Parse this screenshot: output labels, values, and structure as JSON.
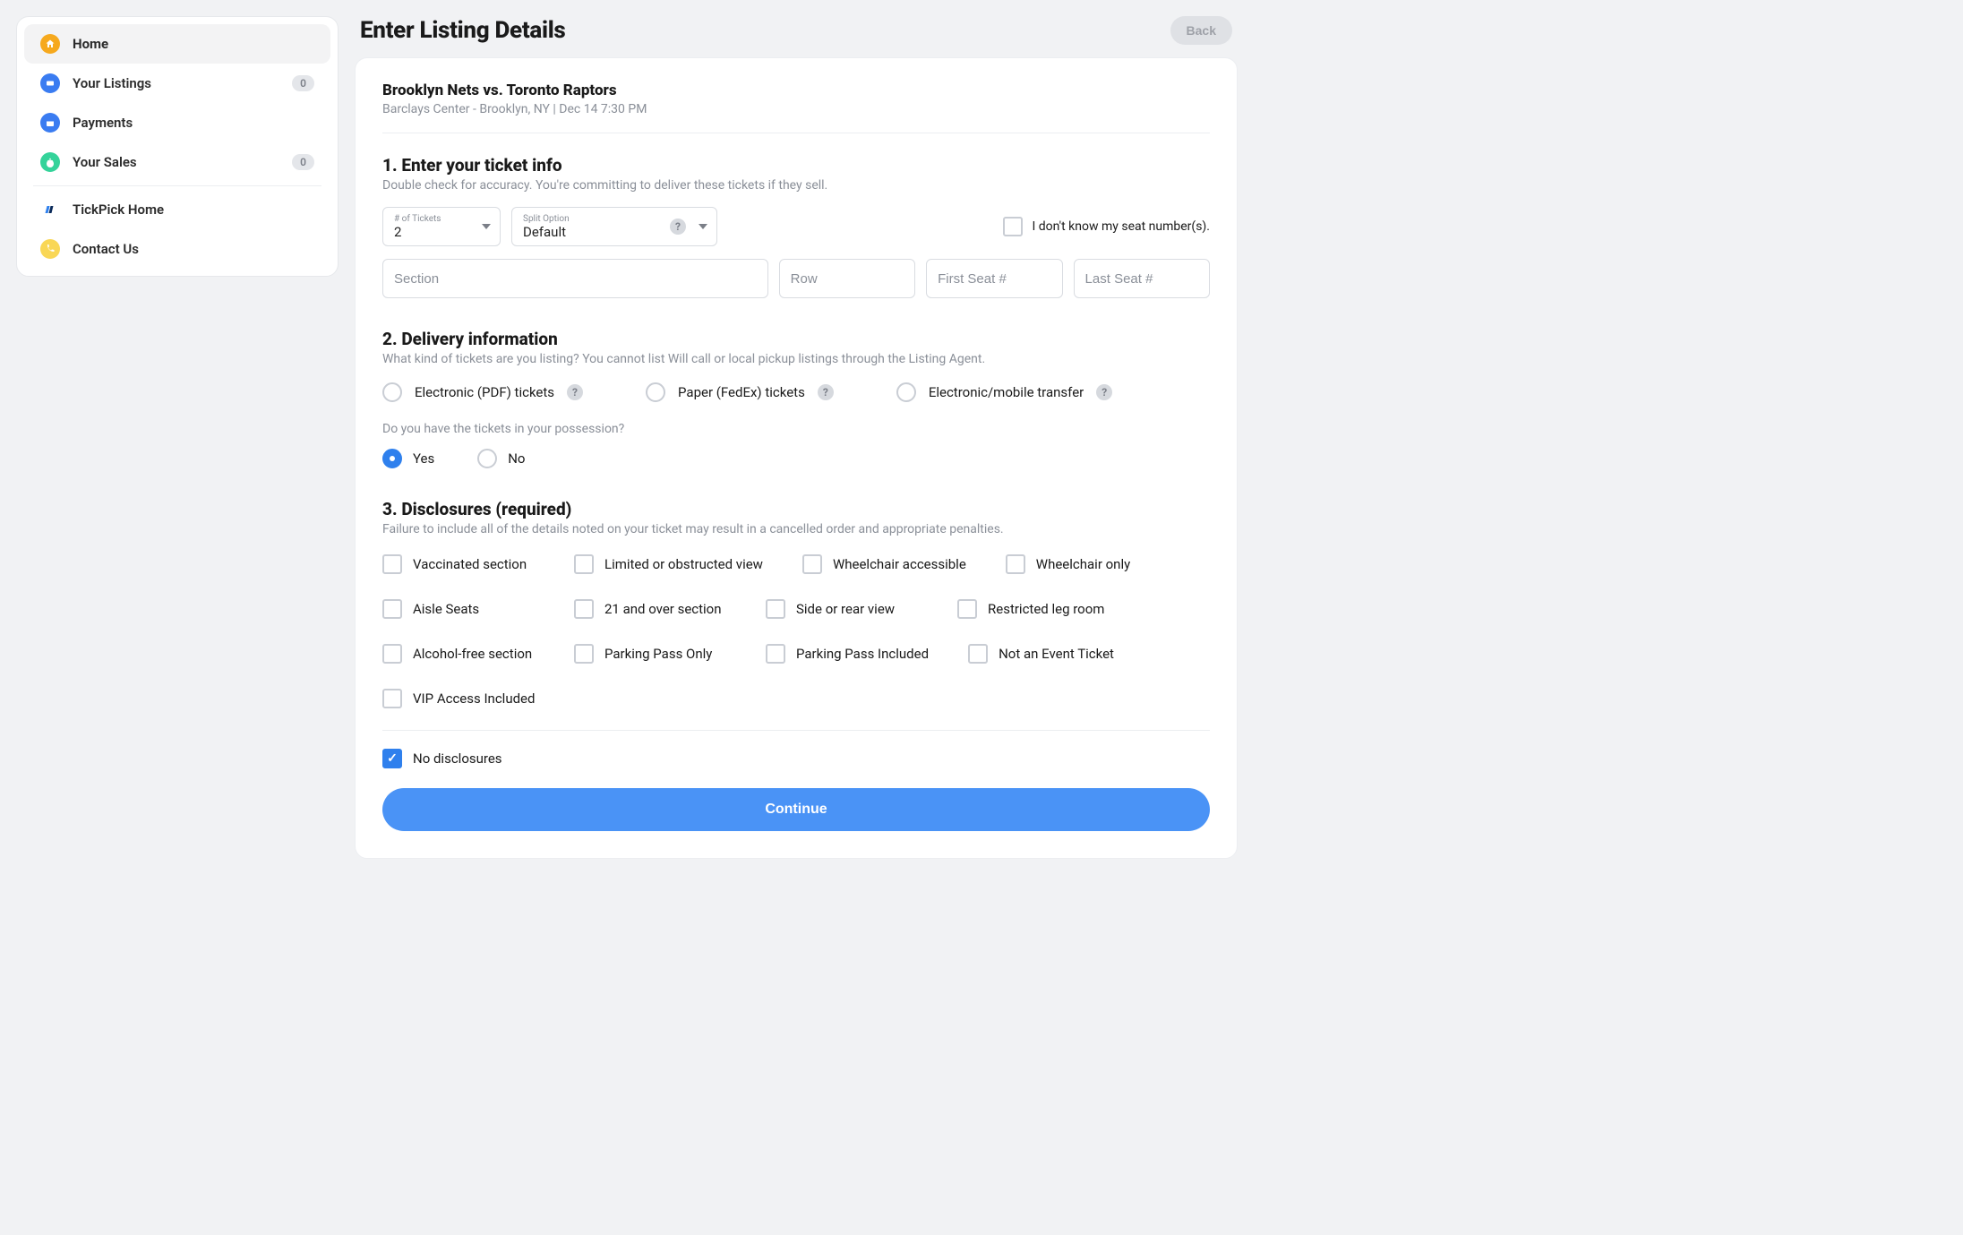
{
  "sidebar": {
    "items": [
      {
        "label": "Home"
      },
      {
        "label": "Your Listings",
        "badge": "0"
      },
      {
        "label": "Payments"
      },
      {
        "label": "Your Sales",
        "badge": "0"
      },
      {
        "label": "TickPick Home"
      },
      {
        "label": "Contact Us"
      }
    ]
  },
  "header": {
    "title": "Enter Listing Details",
    "back": "Back"
  },
  "event": {
    "title": "Brooklyn Nets vs. Toronto Raptors",
    "sub": "Barclays Center - Brooklyn, NY | Dec 14 7:30 PM"
  },
  "section1": {
    "heading": "1. Enter your ticket info",
    "desc": "Double check for accuracy. You're committing to deliver these tickets if they sell.",
    "tickets_label": "# of Tickets",
    "tickets_value": "2",
    "split_label": "Split Option",
    "split_value": "Default",
    "dont_know": "I don't know my seat number(s).",
    "ph_section": "Section",
    "ph_row": "Row",
    "ph_first": "First Seat #",
    "ph_last": "Last Seat #"
  },
  "section2": {
    "heading": "2. Delivery information",
    "desc": "What kind of tickets are you listing? You cannot list Will call or local pickup listings through the Listing Agent.",
    "opt_electronic": "Electronic (PDF) tickets",
    "opt_paper": "Paper (FedEx) tickets",
    "opt_mobile": "Electronic/mobile transfer",
    "possession_q": "Do you have the tickets in your possession?",
    "yes": "Yes",
    "no": "No"
  },
  "section3": {
    "heading": "3. Disclosures (required)",
    "desc": "Failure to include all of the details noted on your ticket may result in a cancelled order and appropriate penalties.",
    "items": [
      "Vaccinated section",
      "Limited or obstructed view",
      "Wheelchair accessible",
      "Wheelchair only",
      "Aisle Seats",
      "21 and over section",
      "Side or rear view",
      "Restricted leg room",
      "Alcohol-free section",
      "Parking Pass Only",
      "Parking Pass Included",
      "Not an Event Ticket",
      "VIP Access Included"
    ],
    "no_disclosures": "No disclosures"
  },
  "continue": "Continue"
}
